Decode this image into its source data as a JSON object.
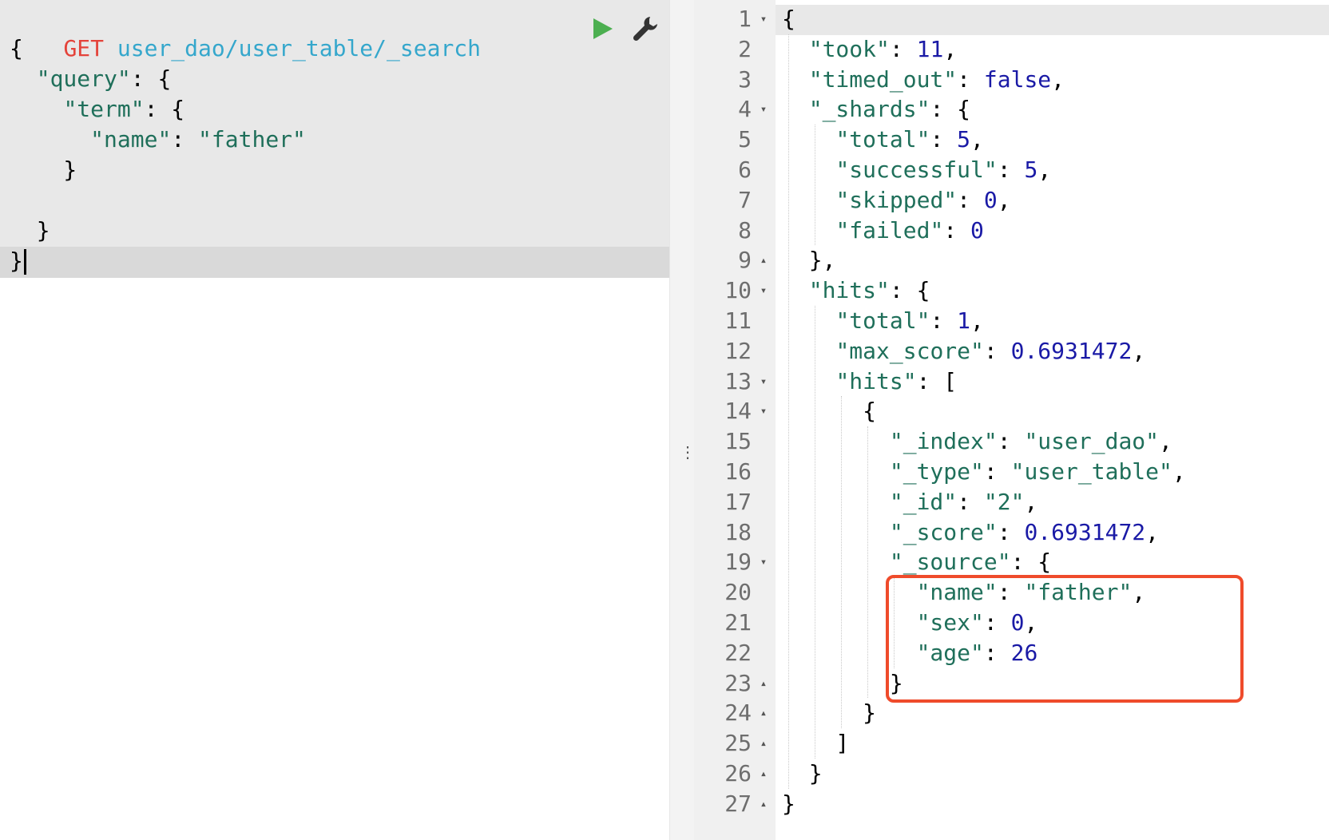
{
  "request": {
    "method": "GET",
    "url": "user_dao/user_table/_search",
    "lines": [
      {
        "parts": [
          {
            "t": "{",
            "c": "punc"
          }
        ]
      },
      {
        "parts": [
          {
            "t": "  ",
            "c": "punc"
          },
          {
            "t": "\"query\"",
            "c": "str"
          },
          {
            "t": ": {",
            "c": "punc"
          }
        ]
      },
      {
        "parts": [
          {
            "t": "    ",
            "c": "punc"
          },
          {
            "t": "\"term\"",
            "c": "str"
          },
          {
            "t": ": {",
            "c": "punc"
          }
        ]
      },
      {
        "parts": [
          {
            "t": "      ",
            "c": "punc"
          },
          {
            "t": "\"name\"",
            "c": "str"
          },
          {
            "t": ": ",
            "c": "punc"
          },
          {
            "t": "\"father\"",
            "c": "str"
          }
        ]
      },
      {
        "parts": [
          {
            "t": "    }",
            "c": "punc"
          }
        ]
      },
      {
        "parts": [
          {
            "t": "",
            "c": "punc"
          }
        ]
      },
      {
        "parts": [
          {
            "t": "  }",
            "c": "punc"
          }
        ]
      },
      {
        "parts": [
          {
            "t": "}",
            "c": "punc"
          }
        ],
        "cursor": true
      }
    ],
    "run_icon": "play-icon",
    "settings_icon": "wrench-icon"
  },
  "splitter": {
    "handle": "⋮"
  },
  "response": {
    "lines": [
      {
        "n": "1",
        "fold": "▾",
        "parts": [
          {
            "t": "{",
            "c": "punc"
          }
        ]
      },
      {
        "n": "2",
        "fold": "",
        "parts": [
          {
            "t": "  ",
            "c": "punc"
          },
          {
            "t": "\"took\"",
            "c": "str"
          },
          {
            "t": ": ",
            "c": "punc"
          },
          {
            "t": "11",
            "c": "num"
          },
          {
            "t": ",",
            "c": "punc"
          }
        ]
      },
      {
        "n": "3",
        "fold": "",
        "parts": [
          {
            "t": "  ",
            "c": "punc"
          },
          {
            "t": "\"timed_out\"",
            "c": "str"
          },
          {
            "t": ": ",
            "c": "punc"
          },
          {
            "t": "false",
            "c": "kw"
          },
          {
            "t": ",",
            "c": "punc"
          }
        ]
      },
      {
        "n": "4",
        "fold": "▾",
        "parts": [
          {
            "t": "  ",
            "c": "punc"
          },
          {
            "t": "\"_shards\"",
            "c": "str"
          },
          {
            "t": ": {",
            "c": "punc"
          }
        ]
      },
      {
        "n": "5",
        "fold": "",
        "parts": [
          {
            "t": "    ",
            "c": "punc"
          },
          {
            "t": "\"total\"",
            "c": "str"
          },
          {
            "t": ": ",
            "c": "punc"
          },
          {
            "t": "5",
            "c": "num"
          },
          {
            "t": ",",
            "c": "punc"
          }
        ]
      },
      {
        "n": "6",
        "fold": "",
        "parts": [
          {
            "t": "    ",
            "c": "punc"
          },
          {
            "t": "\"successful\"",
            "c": "str"
          },
          {
            "t": ": ",
            "c": "punc"
          },
          {
            "t": "5",
            "c": "num"
          },
          {
            "t": ",",
            "c": "punc"
          }
        ]
      },
      {
        "n": "7",
        "fold": "",
        "parts": [
          {
            "t": "    ",
            "c": "punc"
          },
          {
            "t": "\"skipped\"",
            "c": "str"
          },
          {
            "t": ": ",
            "c": "punc"
          },
          {
            "t": "0",
            "c": "num"
          },
          {
            "t": ",",
            "c": "punc"
          }
        ]
      },
      {
        "n": "8",
        "fold": "",
        "parts": [
          {
            "t": "    ",
            "c": "punc"
          },
          {
            "t": "\"failed\"",
            "c": "str"
          },
          {
            "t": ": ",
            "c": "punc"
          },
          {
            "t": "0",
            "c": "num"
          }
        ]
      },
      {
        "n": "9",
        "fold": "▴",
        "parts": [
          {
            "t": "  },",
            "c": "punc"
          }
        ]
      },
      {
        "n": "10",
        "fold": "▾",
        "parts": [
          {
            "t": "  ",
            "c": "punc"
          },
          {
            "t": "\"hits\"",
            "c": "str"
          },
          {
            "t": ": {",
            "c": "punc"
          }
        ]
      },
      {
        "n": "11",
        "fold": "",
        "parts": [
          {
            "t": "    ",
            "c": "punc"
          },
          {
            "t": "\"total\"",
            "c": "str"
          },
          {
            "t": ": ",
            "c": "punc"
          },
          {
            "t": "1",
            "c": "num"
          },
          {
            "t": ",",
            "c": "punc"
          }
        ]
      },
      {
        "n": "12",
        "fold": "",
        "parts": [
          {
            "t": "    ",
            "c": "punc"
          },
          {
            "t": "\"max_score\"",
            "c": "str"
          },
          {
            "t": ": ",
            "c": "punc"
          },
          {
            "t": "0.6931472",
            "c": "num"
          },
          {
            "t": ",",
            "c": "punc"
          }
        ]
      },
      {
        "n": "13",
        "fold": "▾",
        "parts": [
          {
            "t": "    ",
            "c": "punc"
          },
          {
            "t": "\"hits\"",
            "c": "str"
          },
          {
            "t": ": [",
            "c": "punc"
          }
        ]
      },
      {
        "n": "14",
        "fold": "▾",
        "parts": [
          {
            "t": "      {",
            "c": "punc"
          }
        ]
      },
      {
        "n": "15",
        "fold": "",
        "parts": [
          {
            "t": "        ",
            "c": "punc"
          },
          {
            "t": "\"_index\"",
            "c": "str"
          },
          {
            "t": ": ",
            "c": "punc"
          },
          {
            "t": "\"user_dao\"",
            "c": "str"
          },
          {
            "t": ",",
            "c": "punc"
          }
        ]
      },
      {
        "n": "16",
        "fold": "",
        "parts": [
          {
            "t": "        ",
            "c": "punc"
          },
          {
            "t": "\"_type\"",
            "c": "str"
          },
          {
            "t": ": ",
            "c": "punc"
          },
          {
            "t": "\"user_table\"",
            "c": "str"
          },
          {
            "t": ",",
            "c": "punc"
          }
        ]
      },
      {
        "n": "17",
        "fold": "",
        "parts": [
          {
            "t": "        ",
            "c": "punc"
          },
          {
            "t": "\"_id\"",
            "c": "str"
          },
          {
            "t": ": ",
            "c": "punc"
          },
          {
            "t": "\"2\"",
            "c": "str"
          },
          {
            "t": ",",
            "c": "punc"
          }
        ]
      },
      {
        "n": "18",
        "fold": "",
        "parts": [
          {
            "t": "        ",
            "c": "punc"
          },
          {
            "t": "\"_score\"",
            "c": "str"
          },
          {
            "t": ": ",
            "c": "punc"
          },
          {
            "t": "0.6931472",
            "c": "num"
          },
          {
            "t": ",",
            "c": "punc"
          }
        ]
      },
      {
        "n": "19",
        "fold": "▾",
        "parts": [
          {
            "t": "        ",
            "c": "punc"
          },
          {
            "t": "\"_source\"",
            "c": "str"
          },
          {
            "t": ": {",
            "c": "punc"
          }
        ]
      },
      {
        "n": "20",
        "fold": "",
        "parts": [
          {
            "t": "          ",
            "c": "punc"
          },
          {
            "t": "\"name\"",
            "c": "str"
          },
          {
            "t": ": ",
            "c": "punc"
          },
          {
            "t": "\"father\"",
            "c": "str"
          },
          {
            "t": ",",
            "c": "punc"
          }
        ]
      },
      {
        "n": "21",
        "fold": "",
        "parts": [
          {
            "t": "          ",
            "c": "punc"
          },
          {
            "t": "\"sex\"",
            "c": "str"
          },
          {
            "t": ": ",
            "c": "punc"
          },
          {
            "t": "0",
            "c": "num"
          },
          {
            "t": ",",
            "c": "punc"
          }
        ]
      },
      {
        "n": "22",
        "fold": "",
        "parts": [
          {
            "t": "          ",
            "c": "punc"
          },
          {
            "t": "\"age\"",
            "c": "str"
          },
          {
            "t": ": ",
            "c": "punc"
          },
          {
            "t": "26",
            "c": "num"
          }
        ]
      },
      {
        "n": "23",
        "fold": "▴",
        "parts": [
          {
            "t": "        }",
            "c": "punc"
          }
        ]
      },
      {
        "n": "24",
        "fold": "▴",
        "parts": [
          {
            "t": "      }",
            "c": "punc"
          }
        ]
      },
      {
        "n": "25",
        "fold": "▴",
        "parts": [
          {
            "t": "    ]",
            "c": "punc"
          }
        ]
      },
      {
        "n": "26",
        "fold": "▴",
        "parts": [
          {
            "t": "  }",
            "c": "punc"
          }
        ]
      },
      {
        "n": "27",
        "fold": "▴",
        "parts": [
          {
            "t": "}",
            "c": "punc"
          }
        ]
      }
    ]
  },
  "colors": {
    "method": "#e4433a",
    "url": "#35a7cc",
    "string": "#1f6f5a",
    "number": "#1a1aa6",
    "highlight_border": "#ef4b2b",
    "run_green": "#4caf50"
  }
}
